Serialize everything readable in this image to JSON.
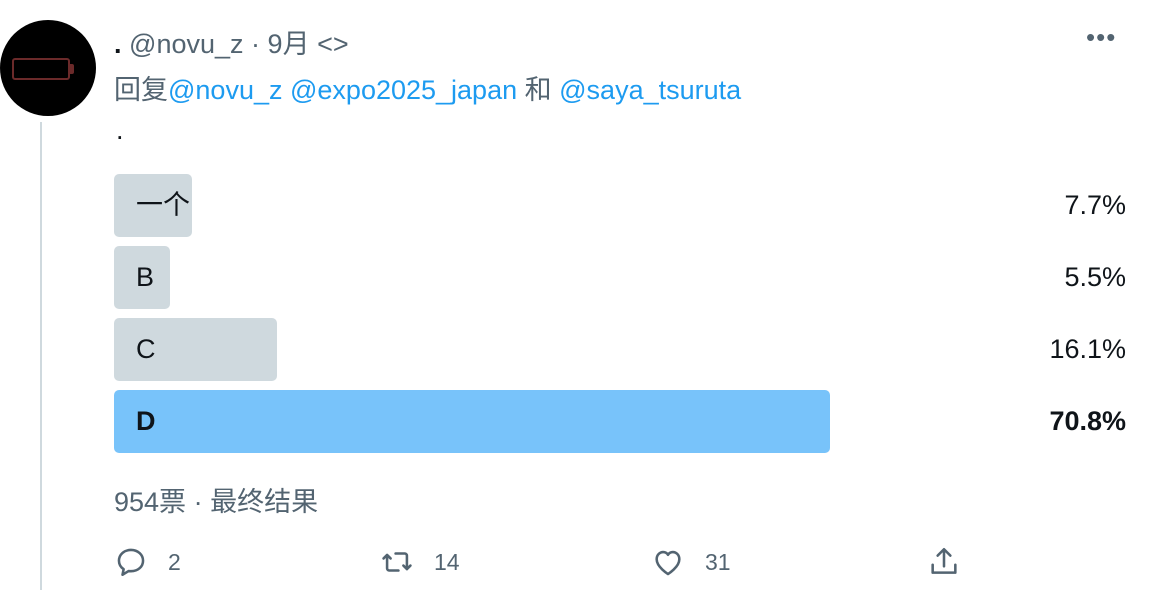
{
  "tweet": {
    "display_name": ".",
    "handle": "@novu_z",
    "separator": "·",
    "date": "9月",
    "code_icon": "<>",
    "more_label": "•••",
    "reply_prefix": "回复",
    "reply_mention_1": "@novu_z",
    "reply_mention_2": "@expo2025_japan",
    "reply_joiner": "和",
    "reply_mention_3": "@saya_tsuruta",
    "text": "."
  },
  "poll": {
    "options": [
      {
        "label": "一个",
        "percent_text": "7.7%",
        "percent": 7.7
      },
      {
        "label": "B",
        "percent_text": "5.5%",
        "percent": 5.5
      },
      {
        "label": "C",
        "percent_text": "16.1%",
        "percent": 16.1
      },
      {
        "label": "D",
        "percent_text": "70.8%",
        "percent": 70.8,
        "winner": true
      }
    ],
    "votes": "954票",
    "meta_separator": "·",
    "status": "最终结果"
  },
  "actions": {
    "reply_count": "2",
    "retweet_count": "14",
    "like_count": "31"
  },
  "colors": {
    "bar": "#cfd9de",
    "winner_bar": "#78c3fa",
    "mention": "#1d9bf0",
    "secondary_text": "#536471"
  },
  "icons": [
    "avatar-battery-icon",
    "more-icon",
    "reply-icon",
    "retweet-icon",
    "like-icon",
    "share-icon"
  ]
}
